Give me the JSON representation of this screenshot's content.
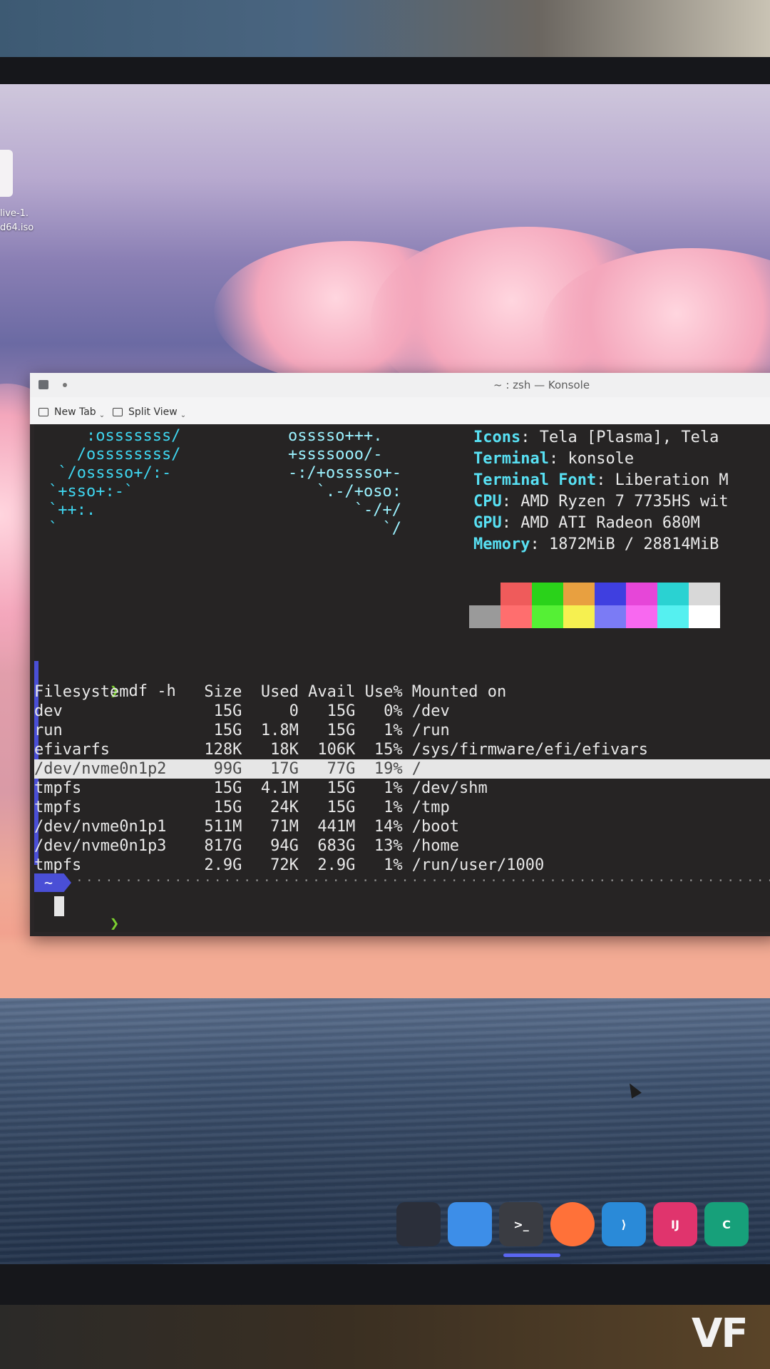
{
  "desktop": {
    "file_icon_label": "live-1.\nd64.iso"
  },
  "window": {
    "title": "~ : zsh — Konsole",
    "toolbar": {
      "new_tab": "New Tab",
      "split_view": "Split View"
    }
  },
  "neofetch": {
    "ascii": [
      "    :osssssss/",
      "   /ossssssss/",
      " `/osssso+/:-",
      "`+sso+:-`",
      "`++:.",
      "`"
    ],
    "ascii_right": [
      "osssso+++.",
      "+ssssooo/-",
      "-:/+osssso+-",
      "   `.-/+oso:",
      "       `-/+/",
      "          `/"
    ],
    "info": [
      {
        "key": "Icons",
        "value": "Tela [Plasma], Tela"
      },
      {
        "key": "Terminal",
        "value": "konsole"
      },
      {
        "key": "Terminal Font",
        "value": "Liberation M"
      },
      {
        "key": "CPU",
        "value": "AMD Ryzen 7 7735HS wit"
      },
      {
        "key": "GPU",
        "value": "AMD ATI Radeon 680M"
      },
      {
        "key": "Memory",
        "value": "1872MiB / 28814MiB"
      }
    ],
    "palette_top": [
      "#262424",
      "#ef5b5b",
      "#2ad21a",
      "#e8a040",
      "#3f3fe0",
      "#e646d8",
      "#2ad2d2",
      "#d8d8d8"
    ],
    "palette_bottom": [
      "#9a9a9a",
      "#ff6e6e",
      "#55f035",
      "#f6f050",
      "#7b7bf5",
      "#f868f0",
      "#55f0f0",
      "#ffffff"
    ]
  },
  "command": {
    "prompt": "❯",
    "text": "df -h"
  },
  "df": {
    "header": "Filesystem        Size  Used Avail Use% Mounted on",
    "rows": [
      "dev                15G     0   15G   0% /dev",
      "run                15G  1.8M   15G   1% /run",
      "efivarfs          128K   18K  106K  15% /sys/firmware/efi/efivars",
      "/dev/nvme0n1p2     99G   17G   77G  19% /",
      "tmpfs              15G  4.1M   15G   1% /dev/shm",
      "tmpfs              15G   24K   15G   1% /tmp",
      "/dev/nvme0n1p1    511M   71M  441M  14% /boot",
      "/dev/nvme0n1p3    817G   94G  683G  13% /home",
      "tmpfs             2.9G   72K  2.9G   1% /run/user/1000"
    ],
    "selected_row": 3
  },
  "prompt2": {
    "segment": "~",
    "arrow": "❯"
  },
  "dock": {
    "items": [
      {
        "name": "window-switcher",
        "label": ""
      },
      {
        "name": "file-manager",
        "label": ""
      },
      {
        "name": "terminal",
        "label": ">_"
      },
      {
        "name": "firefox",
        "label": ""
      },
      {
        "name": "vscode",
        "label": "⟩"
      },
      {
        "name": "intellij",
        "label": "IJ"
      },
      {
        "name": "clion",
        "label": "C"
      }
    ],
    "colors": {
      "window-switcher": "#2b2f3a",
      "file-manager": "#3d8ee8",
      "terminal": "#3a3c42",
      "firefox": "#ff7139",
      "vscode": "#2a8ad8",
      "intellij": "#e0346d",
      "clion": "#17a07a"
    }
  },
  "brand": {
    "monitor_logo": "VF"
  }
}
